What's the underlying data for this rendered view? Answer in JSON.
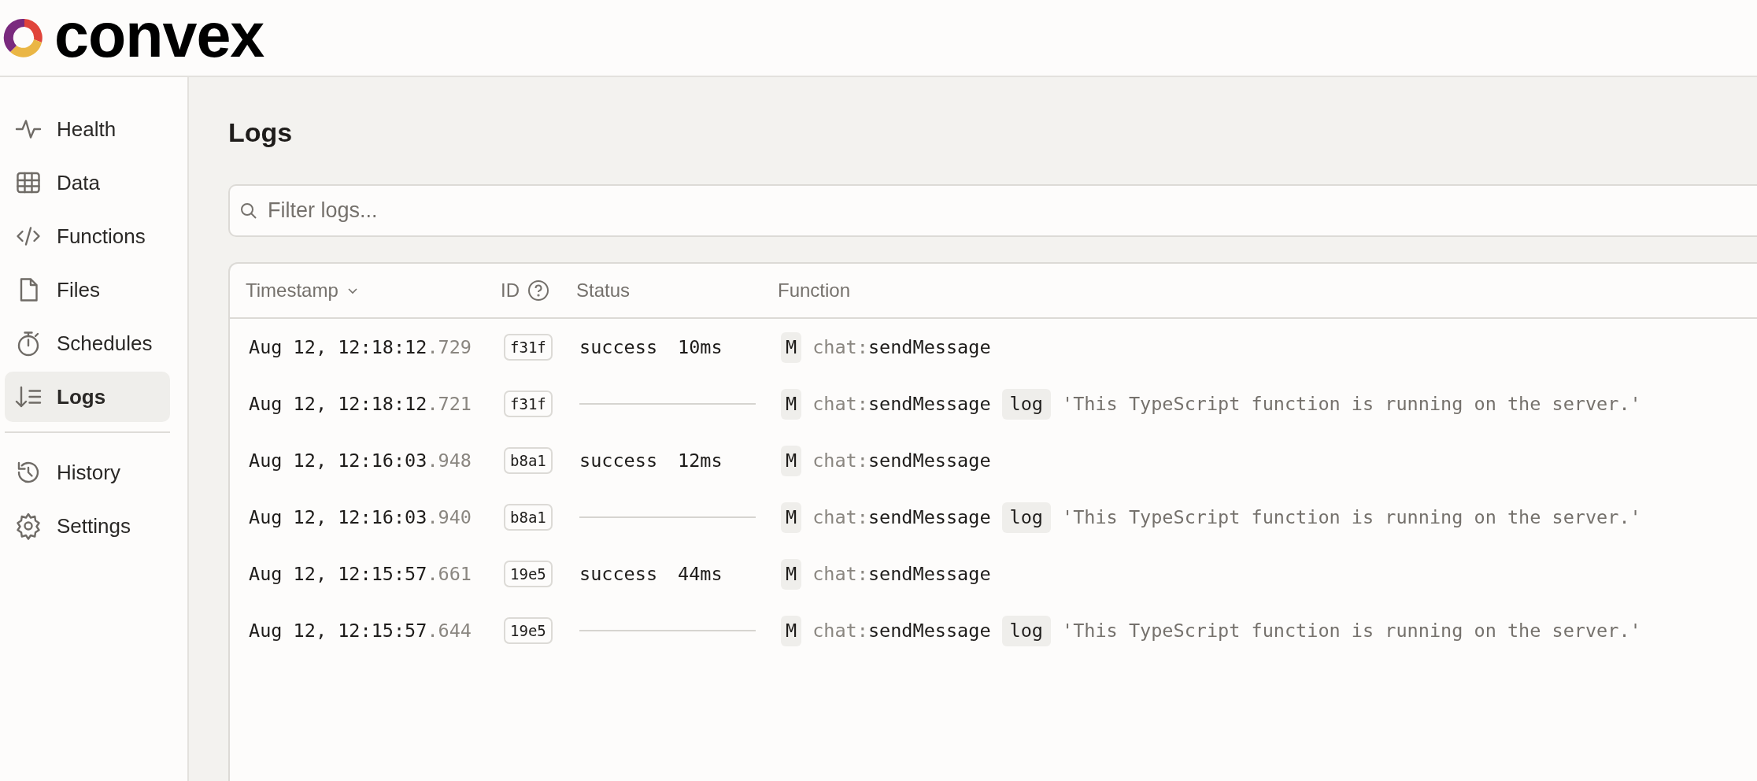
{
  "logo": {
    "text": "convex"
  },
  "sidebar": {
    "groups": [
      [
        {
          "label": "Health",
          "selected": false
        },
        {
          "label": "Data",
          "selected": false
        },
        {
          "label": "Functions",
          "selected": false
        },
        {
          "label": "Files",
          "selected": false
        },
        {
          "label": "Schedules",
          "selected": false
        },
        {
          "label": "Logs",
          "selected": true
        }
      ],
      [
        {
          "label": "History",
          "selected": false
        },
        {
          "label": "Settings",
          "selected": false
        }
      ]
    ]
  },
  "page_title": "Logs",
  "filter": {
    "placeholder": "Filter logs..."
  },
  "table": {
    "columns": [
      "Timestamp",
      "ID",
      "Status",
      "Function"
    ],
    "rows": [
      {
        "kind": "completion",
        "timestamp": "Aug 12, 12:18:12",
        "millis": ".729",
        "id": "f31f",
        "status": "success",
        "duration": "10ms",
        "fn_type": "M",
        "module": "chat:",
        "function": "sendMessage"
      },
      {
        "kind": "log",
        "timestamp": "Aug 12, 12:18:12",
        "millis": ".721",
        "id": "f31f",
        "fn_type": "M",
        "module": "chat:",
        "function": "sendMessage",
        "log_level": "log",
        "message": "'This TypeScript function is running on the server.'"
      },
      {
        "kind": "completion",
        "timestamp": "Aug 12, 12:16:03",
        "millis": ".948",
        "id": "b8a1",
        "status": "success",
        "duration": "12ms",
        "fn_type": "M",
        "module": "chat:",
        "function": "sendMessage"
      },
      {
        "kind": "log",
        "timestamp": "Aug 12, 12:16:03",
        "millis": ".940",
        "id": "b8a1",
        "fn_type": "M",
        "module": "chat:",
        "function": "sendMessage",
        "log_level": "log",
        "message": "'This TypeScript function is running on the server.'"
      },
      {
        "kind": "completion",
        "timestamp": "Aug 12, 12:15:57",
        "millis": ".661",
        "id": "19e5",
        "status": "success",
        "duration": "44ms",
        "fn_type": "M",
        "module": "chat:",
        "function": "sendMessage"
      },
      {
        "kind": "log",
        "timestamp": "Aug 12, 12:15:57",
        "millis": ".644",
        "id": "19e5",
        "fn_type": "M",
        "module": "chat:",
        "function": "sendMessage",
        "log_level": "log",
        "message": "'This TypeScript function is running on the server.'"
      }
    ]
  }
}
